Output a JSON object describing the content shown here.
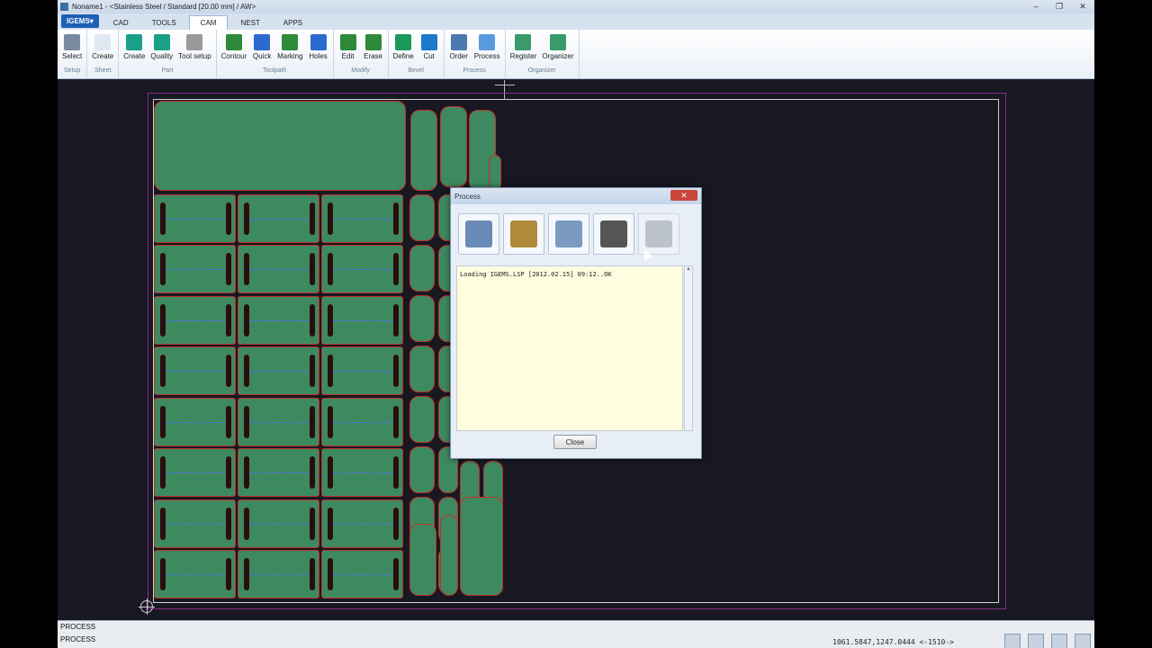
{
  "window": {
    "title": "Noname1 - <Stainless Steel / Standard [20.00 mm] / AW>",
    "controls": [
      "–",
      "❐",
      "✕"
    ]
  },
  "ribbon_tabs": {
    "app_menu": "IGEMS▾",
    "tabs": [
      "CAD",
      "TOOLS",
      "CAM",
      "NEST",
      "APPS"
    ],
    "active": "CAM"
  },
  "ribbon": {
    "groups": [
      {
        "label": "Setup",
        "buttons": [
          {
            "label": "Select",
            "icon": "select-icon",
            "color": "#7a8aa0"
          }
        ]
      },
      {
        "label": "Sheet",
        "buttons": [
          {
            "label": "Create",
            "icon": "sheet-create-icon",
            "color": "#dfe8f2"
          }
        ]
      },
      {
        "label": "Part",
        "buttons": [
          {
            "label": "Create",
            "icon": "part-create-icon",
            "color": "#1aa088"
          },
          {
            "label": "Quality",
            "icon": "quality-icon",
            "color": "#1aa088"
          },
          {
            "label": "Tool setup",
            "icon": "tool-setup-icon",
            "color": "#9a9a9a"
          }
        ]
      },
      {
        "label": "Toolpath",
        "buttons": [
          {
            "label": "Contour",
            "icon": "contour-icon",
            "color": "#2d8a3a"
          },
          {
            "label": "Quick",
            "icon": "quick-icon",
            "color": "#2d6ad0"
          },
          {
            "label": "Marking",
            "icon": "marking-icon",
            "color": "#2d8a3a"
          },
          {
            "label": "Holes",
            "icon": "holes-icon",
            "color": "#2d6ad0"
          }
        ]
      },
      {
        "label": "Modify",
        "buttons": [
          {
            "label": "Edit",
            "icon": "edit-icon",
            "color": "#2d8a3a"
          },
          {
            "label": "Erase",
            "icon": "erase-icon",
            "color": "#2d8a3a"
          }
        ]
      },
      {
        "label": "Bevel",
        "buttons": [
          {
            "label": "Define",
            "icon": "define-icon",
            "color": "#1a9a5a"
          },
          {
            "label": "Cut",
            "icon": "cut-icon",
            "color": "#1a7acb"
          }
        ]
      },
      {
        "label": "Process",
        "buttons": [
          {
            "label": "Order",
            "icon": "order-icon",
            "color": "#4a7ab0"
          },
          {
            "label": "Process",
            "icon": "process-icon",
            "color": "#5a9ae0"
          }
        ]
      },
      {
        "label": "Organizer",
        "buttons": [
          {
            "label": "Register",
            "icon": "register-icon",
            "color": "#3a9a6a"
          },
          {
            "label": "Organizer",
            "icon": "organizer-icon",
            "color": "#3a9a6a"
          }
        ]
      }
    ]
  },
  "dialog": {
    "title": "Process",
    "icons": [
      {
        "icon": "report-icon",
        "color": "#6a8ab8"
      },
      {
        "icon": "money-icon",
        "color": "#b08a3a"
      },
      {
        "icon": "calculator-icon",
        "color": "#7a9ac0"
      },
      {
        "icon": "gears-icon",
        "color": "#555555"
      },
      {
        "icon": "export-icon",
        "color": "#9aa0a8"
      }
    ],
    "log": "Loading IGEMS.LSP [2012.02.15] 09:12..OK",
    "close_label": "Close",
    "close_x": "✕"
  },
  "command_line": {
    "line1": "PROCESS",
    "line2": "PROCESS"
  },
  "status": {
    "coords": "1061.5847,1247.0444 <-1510->"
  }
}
